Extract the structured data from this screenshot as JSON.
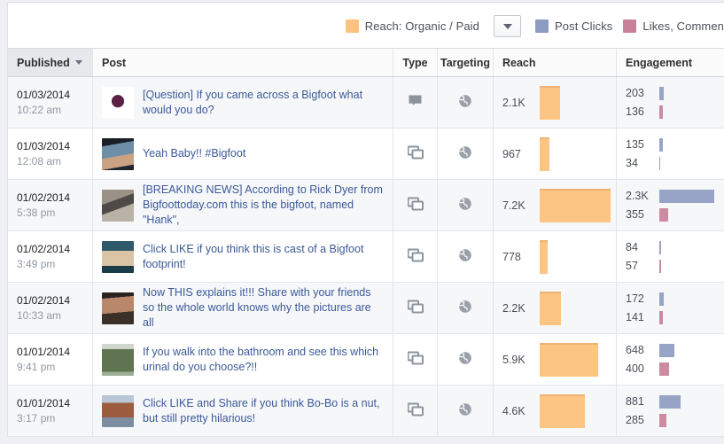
{
  "legend": {
    "items": [
      {
        "label": "Reach: Organic / Paid",
        "color": "#fbc37f",
        "name": "legend-reach"
      },
      {
        "label": "Post Clicks",
        "color": "#8d9cc2",
        "name": "legend-post-clicks"
      },
      {
        "label": "Likes, Commen",
        "color": "#c9819a",
        "name": "legend-likes-comments"
      }
    ],
    "dropdown_icon": "chevron-down-icon"
  },
  "table": {
    "columns": [
      {
        "key": "published",
        "label": "Published",
        "sorted": true,
        "sort_icon": "sort-desc-caret-icon"
      },
      {
        "key": "post",
        "label": "Post"
      },
      {
        "key": "type",
        "label": "Type"
      },
      {
        "key": "targeting",
        "label": "Targeting"
      },
      {
        "key": "reach",
        "label": "Reach"
      },
      {
        "key": "engagement",
        "label": "Engagement"
      }
    ],
    "rows": [
      {
        "date": "01/03/2014",
        "time": "10:22 am",
        "post": "[Question] If you came across a Bigfoot what would you do?",
        "type_icon": "status-post-icon",
        "targeting_icon": "globe-icon",
        "reach_label": "2.1K",
        "reach_value": 2100,
        "post_clicks": "203",
        "post_clicks_value": 203,
        "likes_comments": "136",
        "likes_comments_value": 136
      },
      {
        "date": "01/03/2014",
        "time": "12:08 am",
        "post": "Yeah Baby!! #Bigfoot",
        "type_icon": "photo-post-icon",
        "targeting_icon": "globe-icon",
        "reach_label": "967",
        "reach_value": 967,
        "post_clicks": "135",
        "post_clicks_value": 135,
        "likes_comments": "34",
        "likes_comments_value": 34
      },
      {
        "date": "01/02/2014",
        "time": "5:38 pm",
        "post": "[BREAKING NEWS] According to Rick Dyer from Bigfoottoday.com this is the bigfoot, named \"Hank\",",
        "type_icon": "photo-post-icon",
        "targeting_icon": "globe-icon",
        "reach_label": "7.2K",
        "reach_value": 7200,
        "post_clicks": "2.3K",
        "post_clicks_value": 2300,
        "likes_comments": "355",
        "likes_comments_value": 355
      },
      {
        "date": "01/02/2014",
        "time": "3:49 pm",
        "post": "Click LIKE if you think this is cast of a Bigfoot footprint!",
        "type_icon": "photo-post-icon",
        "targeting_icon": "globe-icon",
        "reach_label": "778",
        "reach_value": 778,
        "post_clicks": "84",
        "post_clicks_value": 84,
        "likes_comments": "57",
        "likes_comments_value": 57
      },
      {
        "date": "01/02/2014",
        "time": "10:33 am",
        "post": "Now THIS explains it!!! Share with your friends so the whole world knows why the pictures are all",
        "type_icon": "photo-post-icon",
        "targeting_icon": "globe-icon",
        "reach_label": "2.2K",
        "reach_value": 2200,
        "post_clicks": "172",
        "post_clicks_value": 172,
        "likes_comments": "141",
        "likes_comments_value": 141
      },
      {
        "date": "01/01/2014",
        "time": "9:41 pm",
        "post": "If you walk into the bathroom and see this which urinal do you choose?!!",
        "type_icon": "photo-post-icon",
        "targeting_icon": "globe-icon",
        "reach_label": "5.9K",
        "reach_value": 5900,
        "post_clicks": "648",
        "post_clicks_value": 648,
        "likes_comments": "400",
        "likes_comments_value": 400
      },
      {
        "date": "01/01/2014",
        "time": "3:17 pm",
        "post": "Click LIKE and Share if you think Bo-Bo is a nut, but still pretty hilarious!",
        "type_icon": "photo-post-icon",
        "targeting_icon": "globe-icon",
        "reach_label": "4.6K",
        "reach_value": 4600,
        "post_clicks": "881",
        "post_clicks_value": 881,
        "likes_comments": "285",
        "likes_comments_value": 285
      }
    ]
  },
  "chart_data": {
    "type": "bar",
    "title": "",
    "categories": [
      "01/03/2014 10:22 am",
      "01/03/2014 12:08 am",
      "01/02/2014 5:38 pm",
      "01/02/2014 3:49 pm",
      "01/02/2014 10:33 am",
      "01/01/2014 9:41 pm",
      "01/01/2014 3:17 pm"
    ],
    "series": [
      {
        "name": "Reach: Organic / Paid",
        "color": "#fbc37f",
        "values": [
          2100,
          967,
          7200,
          778,
          2200,
          5900,
          4600
        ]
      },
      {
        "name": "Post Clicks",
        "color": "#8d9cc2",
        "values": [
          203,
          135,
          2300,
          84,
          172,
          648,
          881
        ]
      },
      {
        "name": "Likes, Comments",
        "color": "#c9819a",
        "values": [
          136,
          34,
          355,
          57,
          141,
          400,
          285
        ]
      }
    ],
    "legend_position": "top-right",
    "grid": false
  }
}
